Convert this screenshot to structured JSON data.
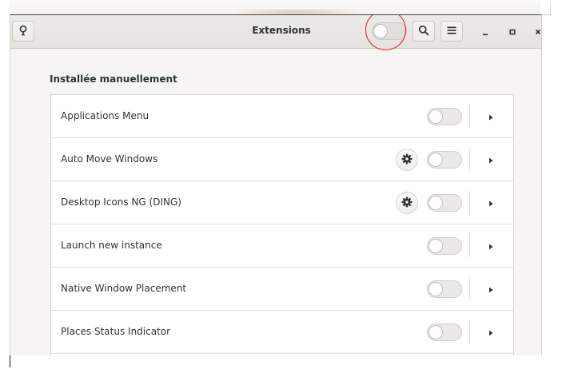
{
  "window": {
    "title": "Extensions"
  },
  "header": {
    "master_toggle_on": false
  },
  "section": {
    "heading": "Installée manuellement"
  },
  "extensions": [
    {
      "name": "Applications Menu",
      "has_settings": false,
      "enabled": false
    },
    {
      "name": "Auto Move Windows",
      "has_settings": true,
      "enabled": false
    },
    {
      "name": "Desktop Icons NG (DING)",
      "has_settings": true,
      "enabled": false
    },
    {
      "name": "Launch new instance",
      "has_settings": false,
      "enabled": false
    },
    {
      "name": "Native Window Placement",
      "has_settings": false,
      "enabled": false
    },
    {
      "name": "Places Status Indicator",
      "has_settings": false,
      "enabled": false
    },
    {
      "name": "",
      "has_settings": false,
      "enabled": false
    }
  ],
  "icons": {
    "about": "lightbulb-icon",
    "search": "search-icon",
    "menu": "hamburger-menu-icon",
    "minimize": "minimize-icon",
    "maximize": "maximize-icon",
    "close": "close-icon",
    "settings": "gear-icon",
    "expand": "chevron-right-icon"
  },
  "colors": {
    "annotation_ring": "#d01818",
    "text": "#2e3436",
    "window_bg": "#f6f5f4",
    "list_bg": "#ffffff"
  }
}
